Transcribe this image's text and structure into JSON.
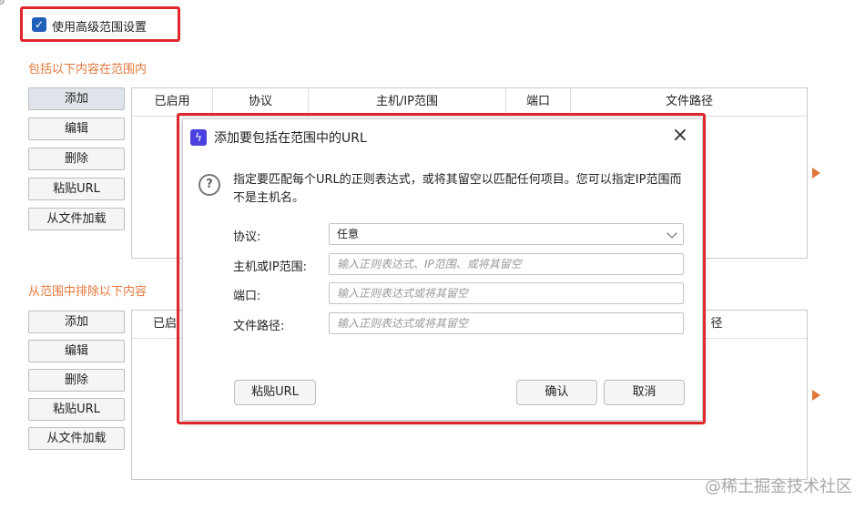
{
  "advanced": {
    "checked": true,
    "label": "使用高级范围设置"
  },
  "include": {
    "title": "包括以下内容在范围内",
    "buttons": {
      "add": "添加",
      "edit": "编辑",
      "delete": "删除",
      "paste_url": "粘贴URL",
      "load_file": "从文件加载"
    },
    "columns": [
      "已启用",
      "协议",
      "主机/IP范围",
      "端口",
      "文件路径"
    ]
  },
  "exclude": {
    "title": "从范围中排除以下内容",
    "buttons": {
      "add": "添加",
      "edit": "编辑",
      "delete": "删除",
      "paste_url": "粘贴URL",
      "load_file": "从文件加载"
    },
    "columns": [
      "已启",
      "径"
    ]
  },
  "dialog": {
    "title": "添加要包括在范围中的URL",
    "description": "指定要匹配每个URL的正则表达式，或将其留空以匹配任何项目。您可以指定IP范围而不是主机名。",
    "protocol_label": "协议:",
    "protocol_value": "任意",
    "host_label": "主机或IP范围:",
    "host_placeholder": "输入正则表达式、IP范围、或将其留空",
    "port_label": "端口:",
    "port_placeholder": "输入正则表达式或将其留空",
    "path_label": "文件路径:",
    "path_placeholder": "输入正则表达式或将其留空",
    "paste_url": "粘贴URL",
    "ok": "确认",
    "cancel": "取消"
  },
  "icons": {
    "settings": "gear-icon",
    "help": "help-icon",
    "close": "close-icon",
    "app": "lightning-icon",
    "checkbox": "check-icon"
  },
  "colors": {
    "section_title": "#e2773a",
    "highlight_border": "#e0262b",
    "checkbox": "#1f5fb8",
    "app_icon": "#4b3fe0"
  },
  "watermark": "@稀土掘金技术社区"
}
